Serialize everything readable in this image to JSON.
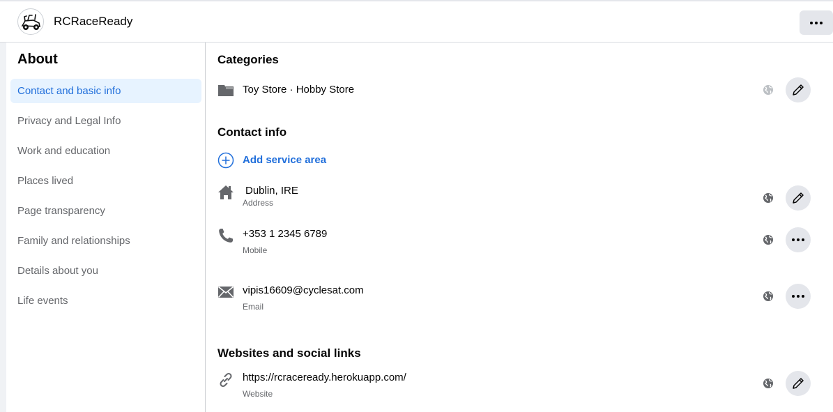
{
  "header": {
    "page_name": "RCRaceReady",
    "avatar_icon": "rc-car-logo",
    "more_icon": "more-dots-icon"
  },
  "sidebar": {
    "title": "About",
    "items": [
      {
        "label": "Contact and basic info",
        "active": true
      },
      {
        "label": "Privacy and Legal Info"
      },
      {
        "label": "Work and education"
      },
      {
        "label": "Places lived"
      },
      {
        "label": "Page transparency"
      },
      {
        "label": "Family and relationships"
      },
      {
        "label": "Details about you"
      },
      {
        "label": "Life events"
      }
    ]
  },
  "main": {
    "categories": {
      "title": "Categories",
      "value": "Toy Store · Hobby Store"
    },
    "contact": {
      "title": "Contact info",
      "add_service_area": "Add service area",
      "address": {
        "value": "Dublin, IRE",
        "label": "Address"
      },
      "mobile": {
        "value": "+353 1 2345 6789",
        "label": "Mobile"
      },
      "email": {
        "value": "vipis16609@cyclesat.com",
        "label": "Email"
      }
    },
    "websites": {
      "title": "Websites and social links",
      "website": {
        "value": "https://rcraceready.herokuapp.com/",
        "label": "Website"
      }
    }
  },
  "colors": {
    "accent": "#216fdb",
    "active_bg": "#e7f3ff",
    "muted_text": "#65676b",
    "button_bg": "#e4e6eb"
  }
}
